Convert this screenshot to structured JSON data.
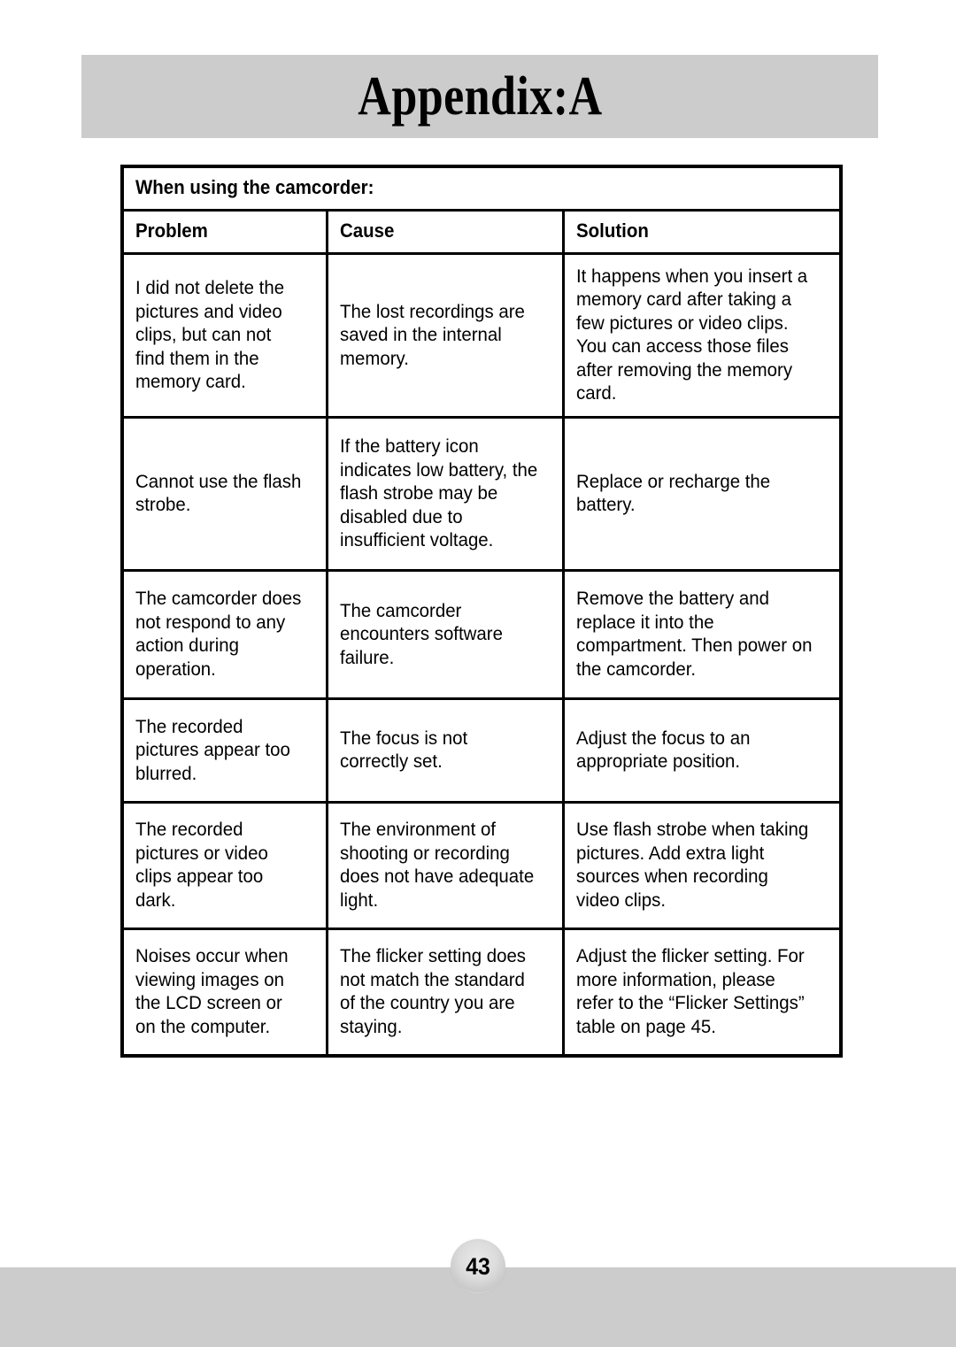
{
  "header": {
    "title": "Appendix:A",
    "band_color": "#cccccc"
  },
  "table": {
    "section_title": "When using the camcorder:",
    "columns": [
      "Problem",
      "Cause",
      "Solution"
    ],
    "rows": [
      {
        "problem": "I did not delete the pictures and video clips, but can not find them in the memory card.",
        "cause": "The lost recordings are saved in the internal memory.",
        "solution": "It happens when you insert a memory card after taking a few pictures or video clips. You can access those files after removing the memory card."
      },
      {
        "problem": "Cannot use the flash strobe.",
        "cause": "If the battery icon indicates low battery, the flash strobe may be disabled due to insufficient voltage.",
        "solution": "Replace or recharge the battery."
      },
      {
        "problem": "The camcorder does not respond to any action during operation.",
        "cause": "The camcorder encounters software failure.",
        "solution": "Remove the battery and replace it into the compartment. Then power on the camcorder."
      },
      {
        "problem": "The recorded pictures appear too blurred.",
        "cause": "The focus is not correctly set.",
        "solution": "Adjust the focus to an appropriate position."
      },
      {
        "problem": "The recorded pictures or video clips appear too dark.",
        "cause": "The environment of shooting or recording does not have adequate light.",
        "solution": "Use flash strobe when taking pictures. Add extra light sources when recording video clips."
      },
      {
        "problem": "Noises occur when viewing images on the LCD screen or on the computer.",
        "cause": "The flicker setting does not match the standard of the country you are staying.",
        "solution": "Adjust the flicker setting. For more information, please refer to the “Flicker Settings” table on page 45."
      }
    ]
  },
  "footer": {
    "page_number": "43",
    "band_color": "#cccccc"
  }
}
